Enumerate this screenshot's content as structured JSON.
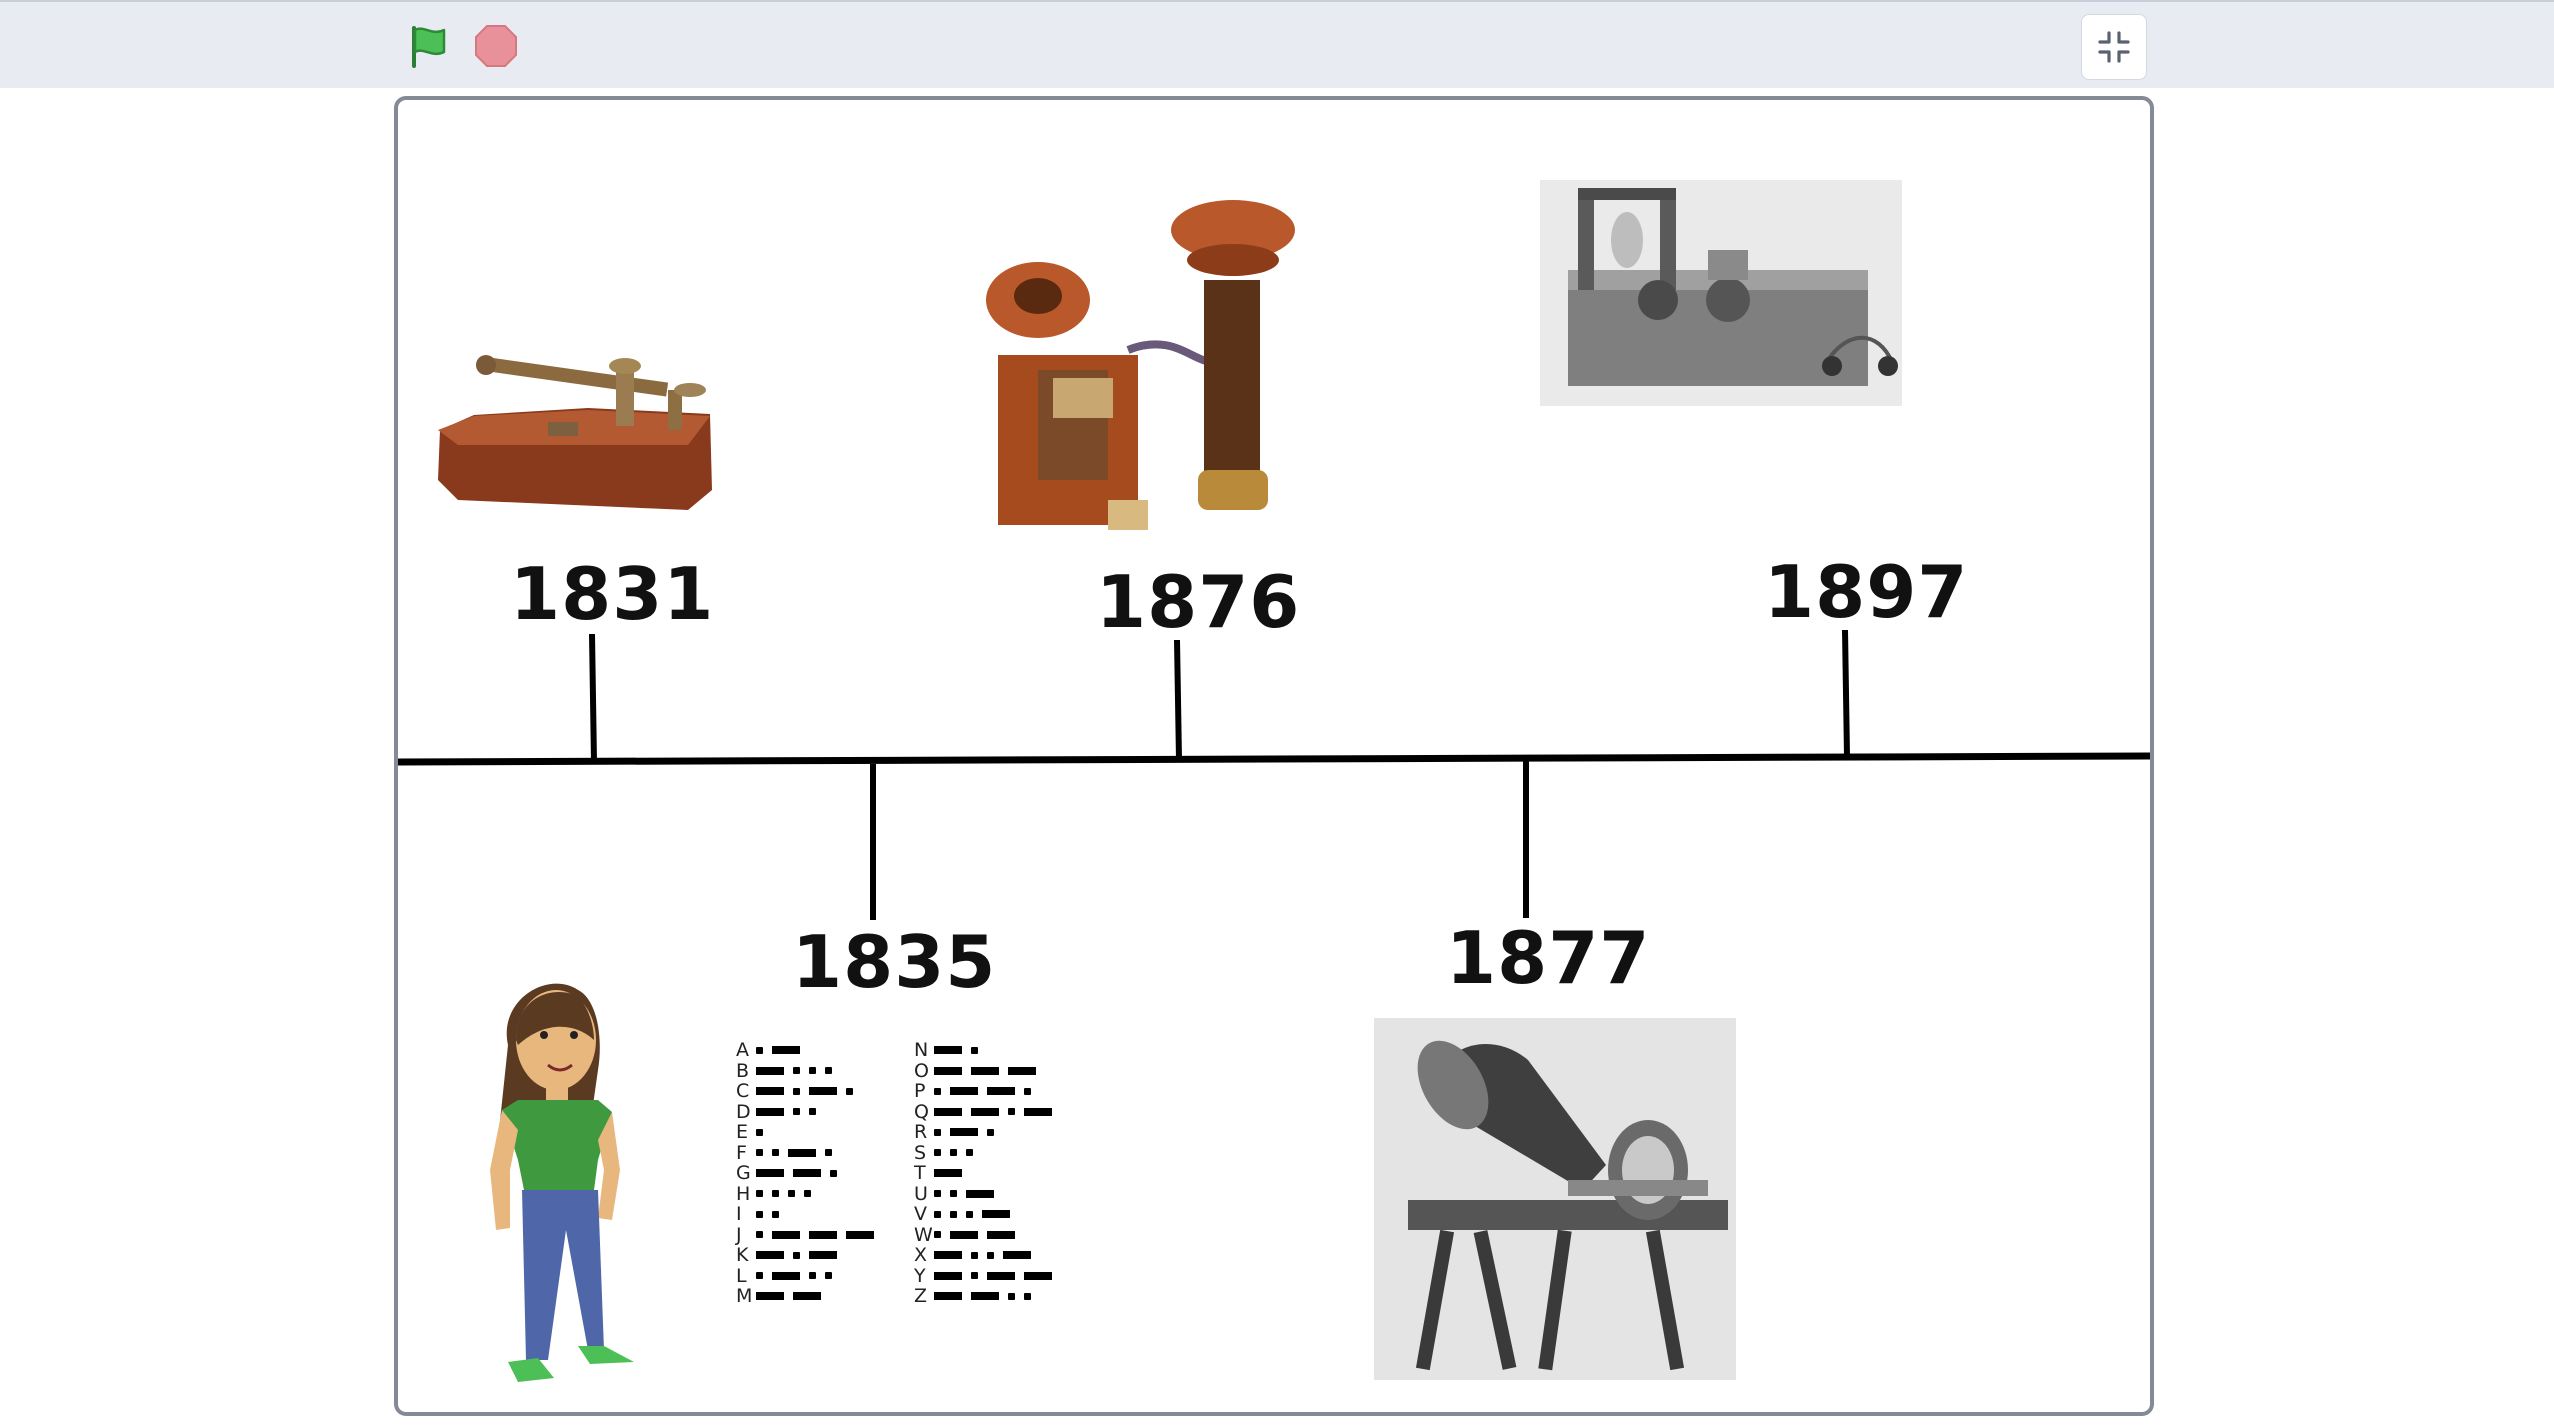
{
  "toolbar": {
    "icons": {
      "green_flag": "green-flag-icon",
      "stop": "stop-icon",
      "fullscreen_exit": "fullscreen-exit-icon"
    },
    "colors": {
      "flag": "#3fa24a",
      "stop": "#e8919a"
    }
  },
  "timeline": {
    "years_top": [
      "1831",
      "1876",
      "1897"
    ],
    "years_bottom": [
      "1835",
      "1877"
    ]
  },
  "morse_chart": {
    "left": [
      {
        "letter": "A",
        "code": ".-"
      },
      {
        "letter": "B",
        "code": "-..."
      },
      {
        "letter": "C",
        "code": "-.-."
      },
      {
        "letter": "D",
        "code": "-.."
      },
      {
        "letter": "E",
        "code": "."
      },
      {
        "letter": "F",
        "code": "..-."
      },
      {
        "letter": "G",
        "code": "--."
      },
      {
        "letter": "H",
        "code": "...."
      },
      {
        "letter": "I",
        "code": ".."
      },
      {
        "letter": "J",
        "code": ".---"
      },
      {
        "letter": "K",
        "code": "-.-"
      },
      {
        "letter": "L",
        "code": ".-.."
      },
      {
        "letter": "M",
        "code": "--"
      }
    ],
    "right": [
      {
        "letter": "N",
        "code": "-."
      },
      {
        "letter": "O",
        "code": "---"
      },
      {
        "letter": "P",
        "code": ".--."
      },
      {
        "letter": "Q",
        "code": "--.-"
      },
      {
        "letter": "R",
        "code": ".-."
      },
      {
        "letter": "S",
        "code": "..."
      },
      {
        "letter": "T",
        "code": "-"
      },
      {
        "letter": "U",
        "code": "..-"
      },
      {
        "letter": "V",
        "code": "...-"
      },
      {
        "letter": "W",
        "code": ".--"
      },
      {
        "letter": "X",
        "code": "-..-"
      },
      {
        "letter": "Y",
        "code": "-.--"
      },
      {
        "letter": "Z",
        "code": "--.."
      }
    ]
  }
}
